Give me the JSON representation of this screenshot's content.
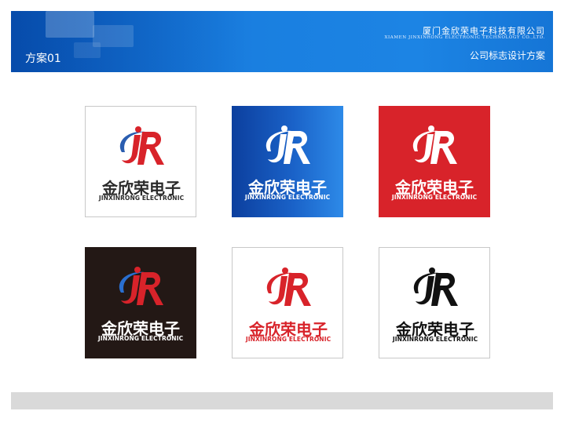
{
  "header": {
    "scheme_label": "方案01",
    "company_cn": "厦门金欣荣电子科技有限公司",
    "company_en": "XIAMEN JINXINRONG ELECTRONIC TECHNOLOGY CO.,LTD.",
    "subtitle": "公司标志设计方案"
  },
  "logos": [
    {
      "variant": "full-color-on-white",
      "cn": "金欣荣电子",
      "en": "JINXINRONG ELECTRONIC",
      "background": "#ffffff",
      "text_color": "#2b2b2b",
      "j_color": "#d8232a",
      "r_color": "#d8232a",
      "swoosh_color": "#2a5db0",
      "en_color": "#2b2b2b"
    },
    {
      "variant": "white-on-blue",
      "cn": "金欣荣电子",
      "en": "JINXINRONG ELECTRONIC",
      "background": "#1a5fc0",
      "text_color": "#ffffff",
      "j_color": "#ffffff",
      "r_color": "#ffffff",
      "swoosh_color": "#ffffff",
      "en_color": "#ffffff"
    },
    {
      "variant": "white-on-red",
      "cn": "金欣荣电子",
      "en": "JINXINRONG ELECTRONIC",
      "background": "#d8232a",
      "text_color": "#ffffff",
      "j_color": "#ffffff",
      "r_color": "#ffffff",
      "swoosh_color": "#ffffff",
      "en_color": "#ffffff"
    },
    {
      "variant": "full-color-on-black",
      "cn": "金欣荣电子",
      "en": "JINXINRONG ELECTRONIC",
      "background": "#231815",
      "text_color": "#ffffff",
      "j_color": "#d8232a",
      "r_color": "#d8232a",
      "swoosh_color": "#2a6fd0",
      "en_color": "#ffffff"
    },
    {
      "variant": "red-on-white",
      "cn": "金欣荣电子",
      "en": "JINXINRONG ELECTRONIC",
      "background": "#ffffff",
      "text_color": "#d8232a",
      "j_color": "#d8232a",
      "r_color": "#d8232a",
      "swoosh_color": "#d8232a",
      "en_color": "#d8232a"
    },
    {
      "variant": "black-on-white",
      "cn": "金欣荣电子",
      "en": "JINXINRONG ELECTRONIC",
      "background": "#ffffff",
      "text_color": "#111111",
      "j_color": "#111111",
      "r_color": "#111111",
      "swoosh_color": "#111111",
      "en_color": "#111111"
    }
  ]
}
